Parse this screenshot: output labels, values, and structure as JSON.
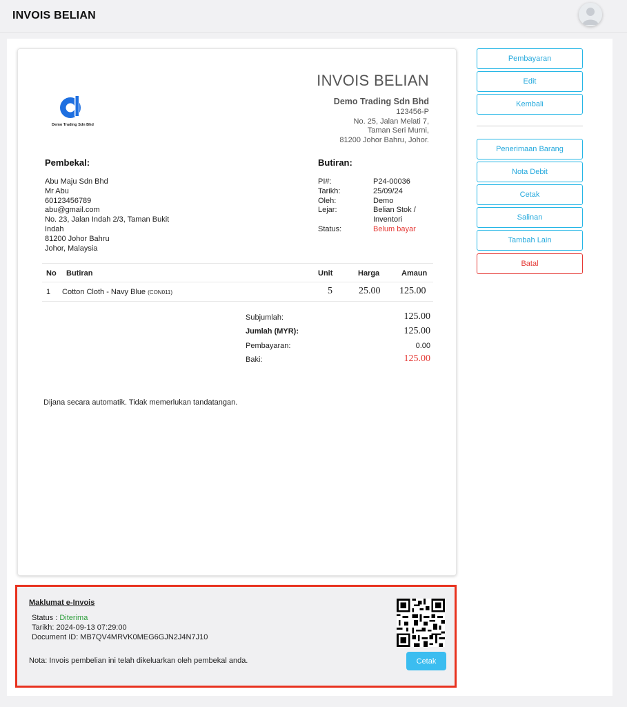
{
  "header": {
    "title": "INVOIS BELIAN"
  },
  "invoice": {
    "heading": "INVOIS BELIAN",
    "logo_text": "Demo Trading Sdn Bhd",
    "company": {
      "name": "Demo Trading Sdn Bhd",
      "reg_no": "123456-P",
      "address": [
        "No. 25, Jalan Melati 7,",
        "Taman Seri Murni,",
        "81200 Johor Bahru, Johor."
      ]
    },
    "supplier": {
      "title": "Pembekal:",
      "lines": [
        "Abu Maju Sdn Bhd",
        "Mr Abu",
        "60123456789",
        "abu@gmail.com",
        "No. 23, Jalan Indah 2/3, Taman Bukit",
        "Indah",
        "81200 Johor Bahru",
        "Johor, Malaysia"
      ]
    },
    "details": {
      "title": "Butiran:",
      "pi_label": "PI#:",
      "pi_value": "P24-00036",
      "date_label": "Tarikh:",
      "date_value": "25/09/24",
      "by_label": "Oleh:",
      "by_value": "Demo",
      "ledger_label": "Lejar:",
      "ledger_value_1": "Belian Stok /",
      "ledger_value_2": "Inventori",
      "status_label": "Status:",
      "status_value": "Belum bayar"
    },
    "table": {
      "headers": {
        "no": "No",
        "item": "Butiran",
        "unit": "Unit",
        "price": "Harga",
        "amount": "Amaun"
      },
      "rows": [
        {
          "no": "1",
          "item": "Cotton Cloth - Navy Blue",
          "code": "(CON011)",
          "unit": "5",
          "price": "25.00",
          "amount": "125.00"
        }
      ]
    },
    "totals": {
      "subtotal_label": "Subjumlah:",
      "subtotal": "125.00",
      "total_label": "Jumlah (MYR):",
      "total": "125.00",
      "payment_label": "Pembayaran:",
      "payment": "0.00",
      "balance_label": "Baki:",
      "balance": "125.00"
    },
    "footer_note": "Dijana secara automatik. Tidak memerlukan tandatangan."
  },
  "einvoice": {
    "title": "Maklumat e-Invois",
    "status_label": "Status : ",
    "status_value": "Diterima",
    "date_line": "Tarikh: 2024-09-13 07:29:00",
    "doc_line": "Document ID: MB7QV4MRVK0MEG6GJN2J4N7J10",
    "note": "Nota: Invois pembelian ini telah dikeluarkan oleh pembekal anda.",
    "print_label": "Cetak"
  },
  "actions": {
    "payment": "Pembayaran",
    "edit": "Edit",
    "back": "Kembali",
    "goods_receipt": "Penerimaan Barang",
    "debit_note": "Nota Debit",
    "print": "Cetak",
    "copy": "Salinan",
    "add_more": "Tambah Lain",
    "cancel": "Batal"
  },
  "colors": {
    "accent": "#25b6e6",
    "danger": "#e53935",
    "success": "#2e9e3c",
    "highlight_border": "#e8321f"
  }
}
